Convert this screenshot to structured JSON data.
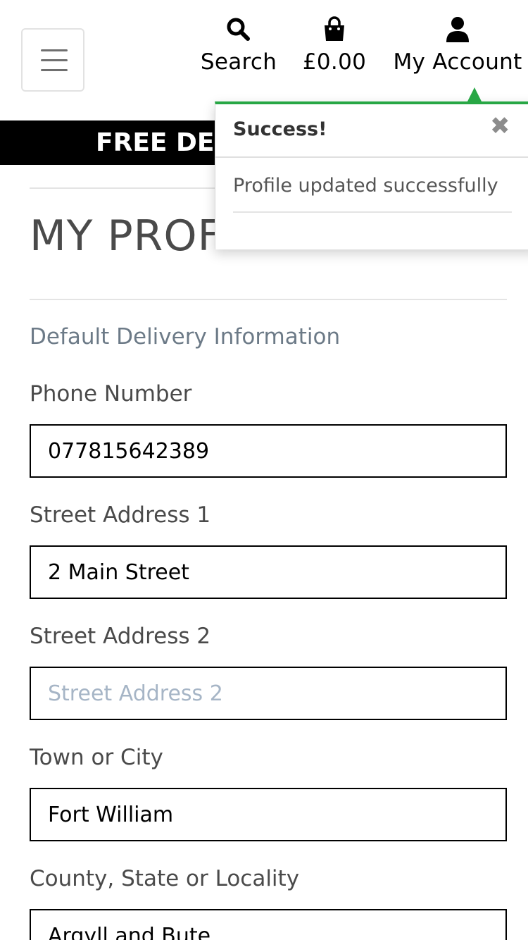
{
  "header": {
    "menu_icon": "hamburger-icon",
    "search": {
      "icon": "search-icon",
      "label": "Search"
    },
    "bag": {
      "icon": "shopping-bag-icon",
      "label": "£0.00"
    },
    "account": {
      "icon": "user-icon",
      "label": "My Account"
    }
  },
  "banner": {
    "text": "FREE DELI"
  },
  "page": {
    "title": "MY PROF",
    "section_title": "Default Delivery Information"
  },
  "form": {
    "fields": [
      {
        "label": "Phone Number",
        "value": "077815642389",
        "placeholder": "Phone Number"
      },
      {
        "label": "Street Address 1",
        "value": "2 Main Street",
        "placeholder": "Street Address 1"
      },
      {
        "label": "Street Address 2",
        "value": "",
        "placeholder": "Street Address 2"
      },
      {
        "label": "Town or City",
        "value": "Fort William",
        "placeholder": "Town or City"
      },
      {
        "label": "County, State or Locality",
        "value": "Argyll and Bute",
        "placeholder": "County, State or Locality"
      }
    ]
  },
  "toast": {
    "title": "Success!",
    "close_icon": "close-icon",
    "message": "Profile updated successfully",
    "accent_color": "#28a745"
  }
}
